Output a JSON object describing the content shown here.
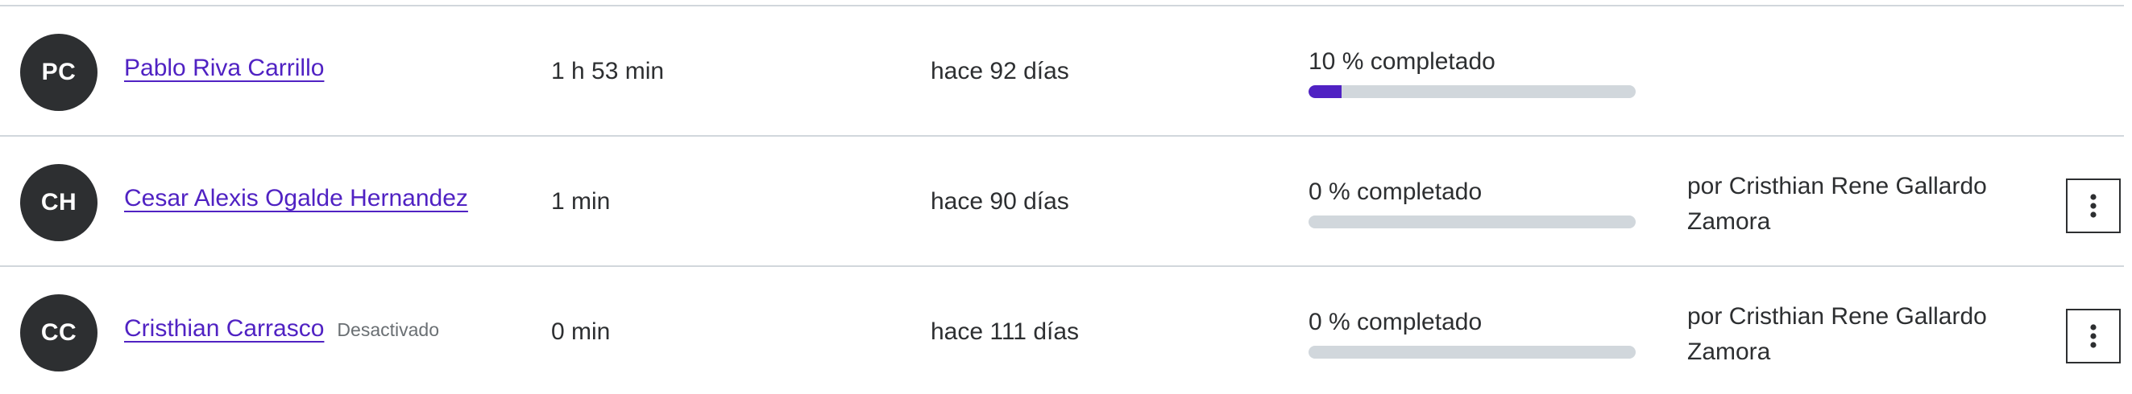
{
  "rows": [
    {
      "initials": "PC",
      "name": "Pablo Riva Carrillo",
      "status": "",
      "duration": "1 h 53 min",
      "last_active": "hace 92 días",
      "progress_label": "10 % completado",
      "progress": 0.1,
      "assigned_by": "",
      "has_menu": false
    },
    {
      "initials": "CH",
      "name": "Cesar Alexis Ogalde Hernandez",
      "status": "",
      "duration": "1 min",
      "last_active": "hace 90 días",
      "progress_label": "0 % completado",
      "progress": 0,
      "assigned_by": "por Cristhian Rene Gallardo Zamora",
      "has_menu": true
    },
    {
      "initials": "CC",
      "name": "Cristhian Carrasco",
      "status": "Desactivado",
      "duration": "0 min",
      "last_active": "hace 111 días",
      "progress_label": "0 % completado",
      "progress": 0,
      "assigned_by": "por Cristhian Rene Gallardo Zamora",
      "has_menu": true
    }
  ],
  "menu_icon": "more-vertical-icon",
  "colors": {
    "link": "#5022c3",
    "progress_fill": "#5022c3",
    "progress_track": "#d1d7dc",
    "avatar_bg": "#2d2f31",
    "divider": "#d1d7dc"
  }
}
